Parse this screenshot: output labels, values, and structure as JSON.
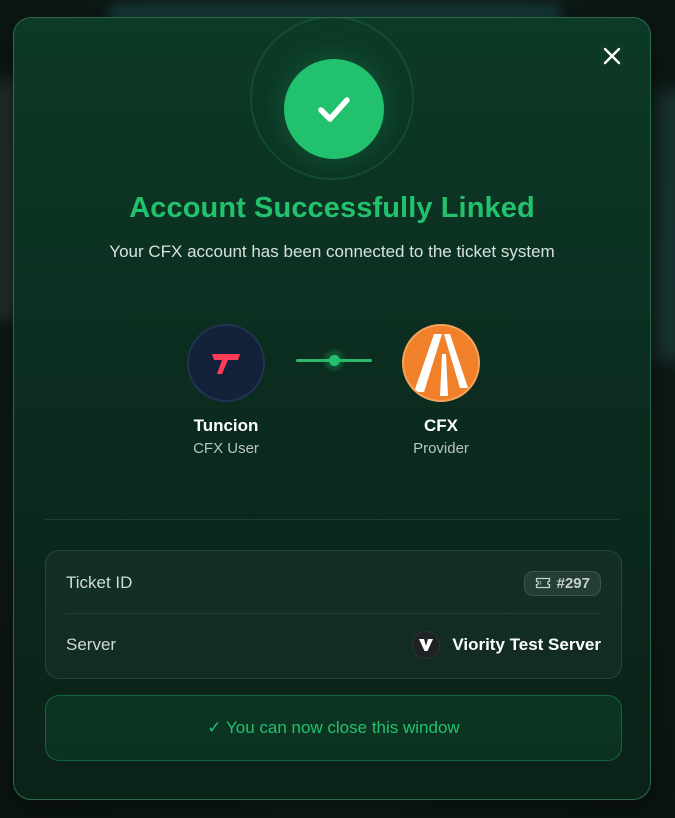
{
  "modal": {
    "title": "Account Successfully Linked",
    "subtitle": "Your CFX account has been connected to the ticket system",
    "close_icon": "close-icon",
    "status_icon": "check-icon",
    "accent_color": "#22c16e"
  },
  "user": {
    "name": "Tuncion",
    "role": "CFX User",
    "avatar_icon": "tuncion-logo-icon",
    "avatar_color": "#ff3b55"
  },
  "provider": {
    "name": "CFX",
    "role": "Provider",
    "avatar_icon": "cfx-logo-icon",
    "avatar_color": "#f0802a"
  },
  "details": {
    "ticket_label": "Ticket ID",
    "ticket_value": "#297",
    "ticket_icon": "ticket-icon",
    "server_label": "Server",
    "server_value": "Viority Test Server",
    "server_icon": "viority-logo-icon"
  },
  "footer": {
    "close_hint": "✓ You can now close this window"
  }
}
